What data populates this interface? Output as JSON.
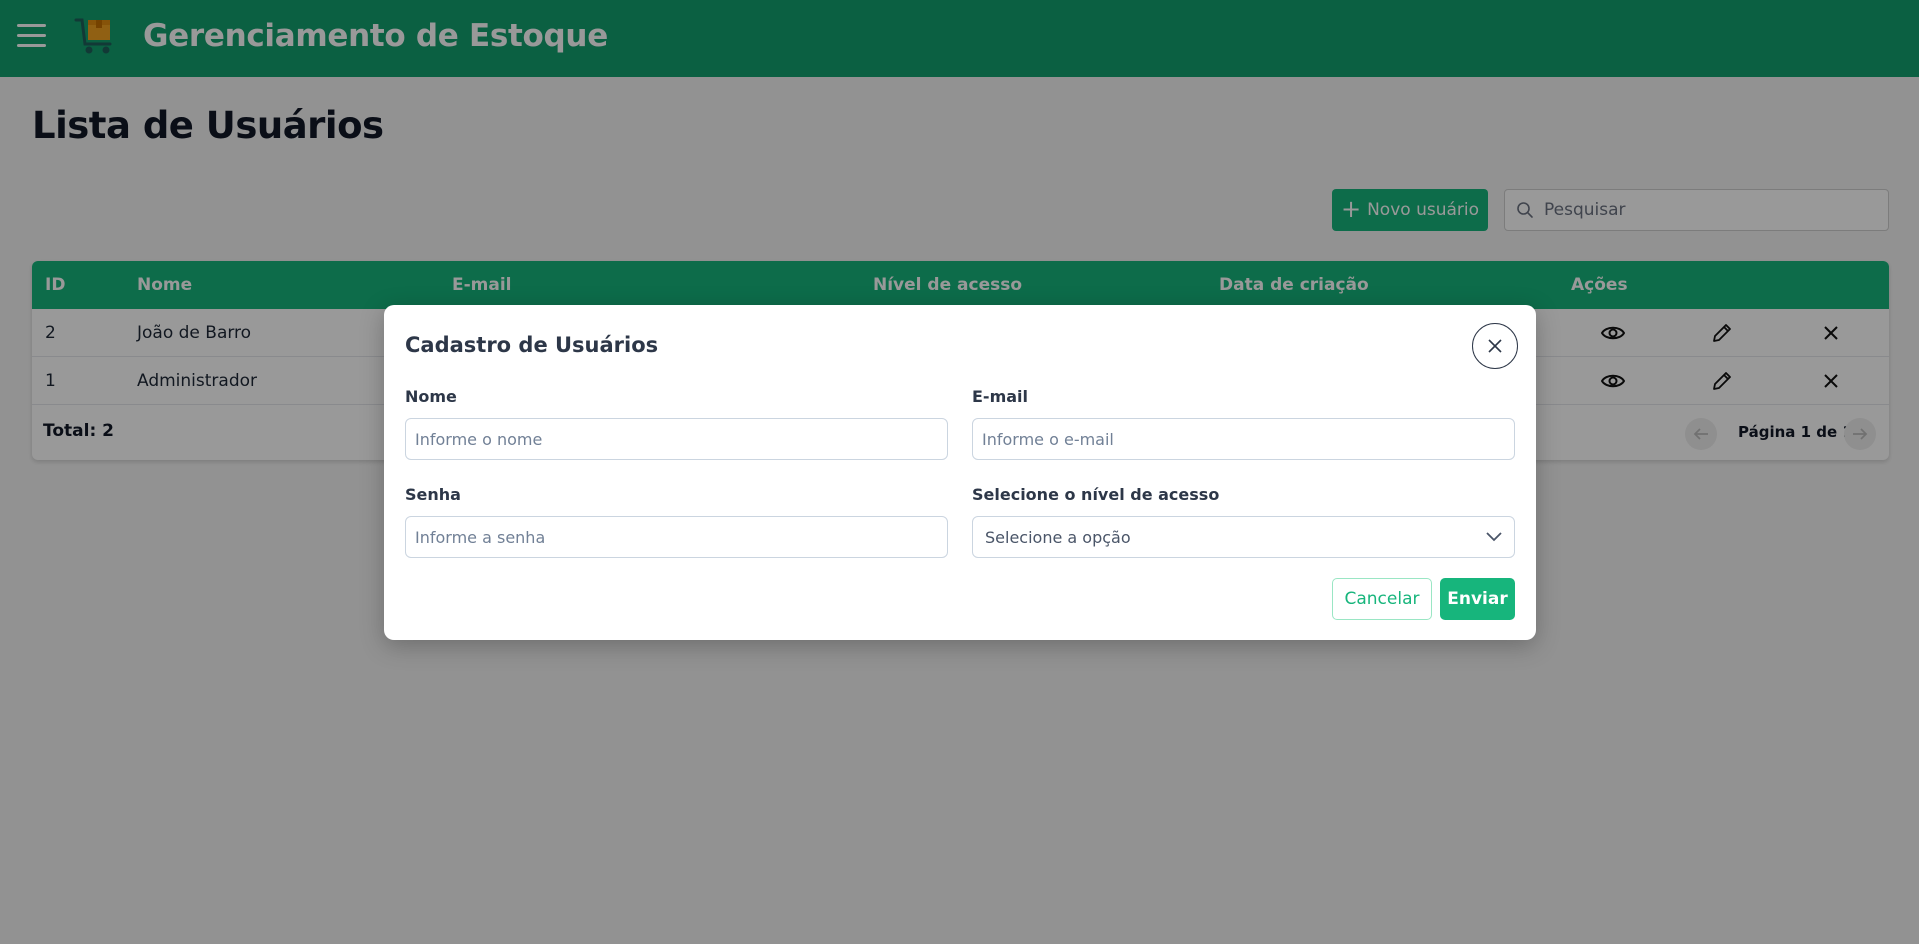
{
  "header": {
    "title": "Gerenciamento de Estoque",
    "menu_icon": "hamburger-menu-icon",
    "logo_icon": "shopping-cart-box-icon",
    "background_color": "#13a06f"
  },
  "page": {
    "title": "Lista de Usuários"
  },
  "toolbar": {
    "new_user_icon": "plus-icon",
    "new_user_label": "Novo usuário",
    "search_icon": "search-icon",
    "search_placeholder": "Pesquisar",
    "accent_color": "#17b57c"
  },
  "table": {
    "columns": [
      "ID",
      "Nome",
      "E-mail",
      "Nível de acesso",
      "Data de criação",
      "Ações"
    ],
    "rows": [
      {
        "id": "2",
        "nome": "João de Barro",
        "actions": [
          "eye-icon",
          "pencil-icon",
          "close-icon"
        ]
      },
      {
        "id": "1",
        "nome": "Administrador",
        "actions": [
          "eye-icon",
          "pencil-icon",
          "close-icon"
        ]
      }
    ],
    "total_label": "Total: 2",
    "pagination": {
      "label": "Página 1 de 1",
      "prev_icon": "arrow-left-icon",
      "next_icon": "arrow-right-icon"
    }
  },
  "modal": {
    "title": "Cadastro de Usuários",
    "close_icon": "close-icon",
    "fields": {
      "nome": {
        "label": "Nome",
        "placeholder": "Informe o nome",
        "value": ""
      },
      "email": {
        "label": "E-mail",
        "placeholder": "Informe o e-mail",
        "value": ""
      },
      "senha": {
        "label": "Senha",
        "placeholder": "Informe a senha",
        "value": ""
      },
      "nivel": {
        "label": "Selecione o nível de acesso",
        "selected": "Selecione a opção",
        "icon": "chevron-down-icon"
      }
    },
    "cancel_label": "Cancelar",
    "submit_label": "Enviar"
  }
}
